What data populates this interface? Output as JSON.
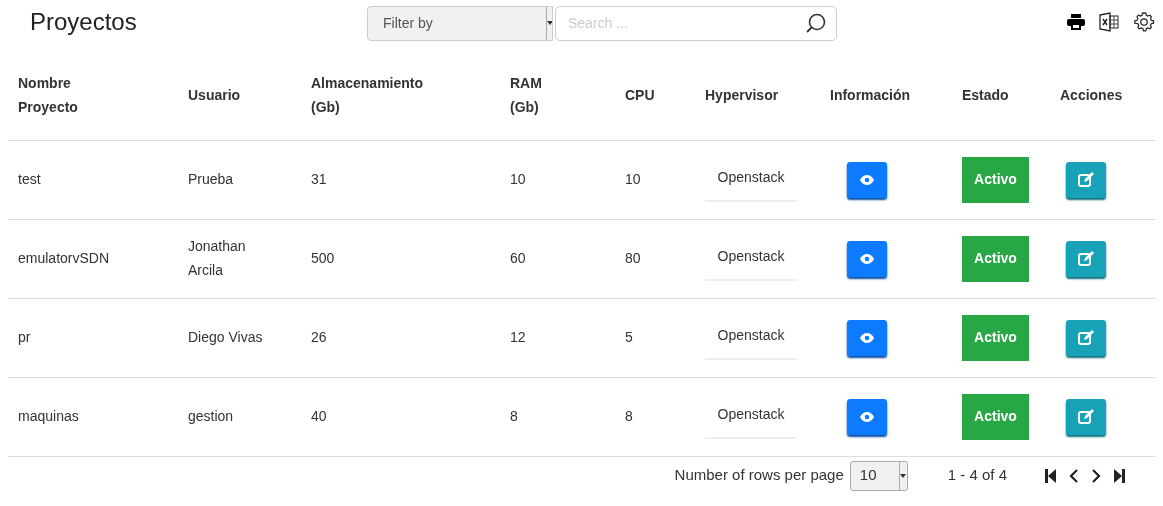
{
  "title": "Proyectos",
  "filter": {
    "placeholder": "Filter by"
  },
  "search": {
    "placeholder": "Search ..."
  },
  "columns": [
    "Nombre Proyecto",
    "Usuario",
    "Almacenamiento (Gb)",
    "RAM (Gb)",
    "CPU",
    "Hypervisor",
    "Información",
    "Estado",
    "Acciones"
  ],
  "rows": [
    {
      "name": "test",
      "user": "Prueba",
      "storage": "31",
      "ram": "10",
      "cpu": "10",
      "hypervisor": "Openstack",
      "status": "Activo"
    },
    {
      "name": "emulatorvSDN",
      "user": "Jonathan Arcila",
      "storage": "500",
      "ram": "60",
      "cpu": "80",
      "hypervisor": "Openstack",
      "status": "Activo"
    },
    {
      "name": "pr",
      "user": "Diego Vivas",
      "storage": "26",
      "ram": "12",
      "cpu": "5",
      "hypervisor": "Openstack",
      "status": "Activo"
    },
    {
      "name": "maquinas",
      "user": "gestion",
      "storage": "40",
      "ram": "8",
      "cpu": "8",
      "hypervisor": "Openstack",
      "status": "Activo"
    }
  ],
  "pagination": {
    "rows_label": "Number of rows per page",
    "rows_per_page": "10",
    "range": "1 - 4 of 4"
  }
}
